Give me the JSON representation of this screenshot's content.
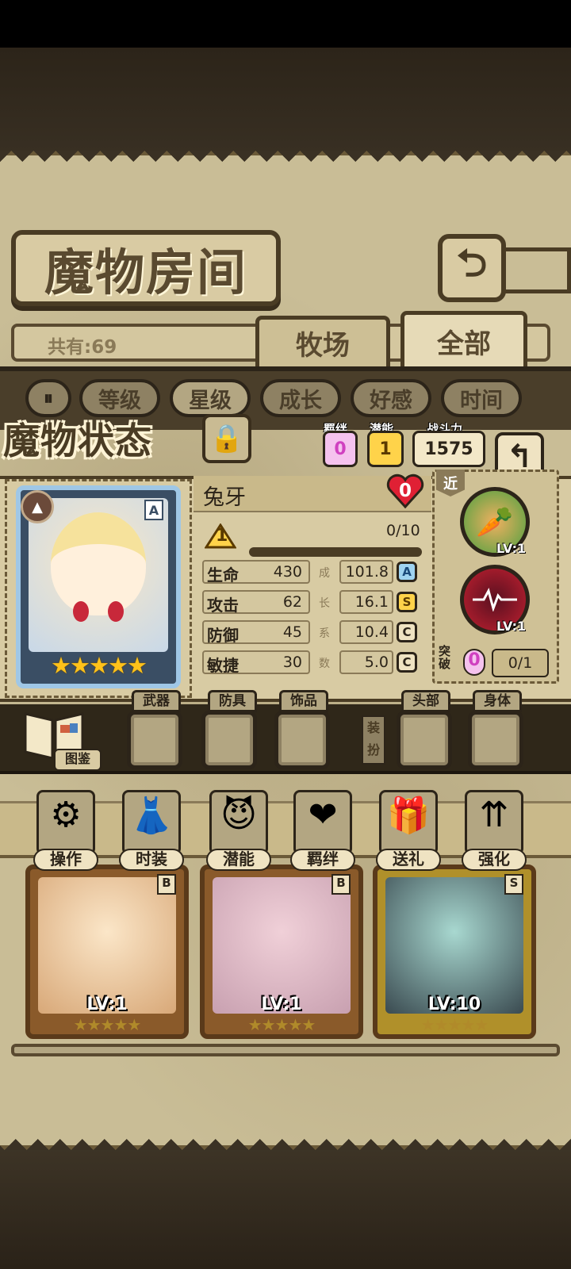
{
  "header": {
    "title": "魔物房间",
    "back_icon": "return-arrow-icon"
  },
  "collection": {
    "count_label": "共有:69"
  },
  "tabs": [
    {
      "label": "牧场"
    },
    {
      "label": "全部"
    }
  ],
  "sort": {
    "toggle_icon": "filter-toggle-icon",
    "buttons": [
      {
        "label": "等级"
      },
      {
        "label": "星级"
      },
      {
        "label": "成长"
      },
      {
        "label": "好感"
      },
      {
        "label": "时间"
      }
    ],
    "active": "星级"
  },
  "status": {
    "title": "魔物状态",
    "bond_label": "羁绊",
    "bond_value": "0",
    "potential_label": "潜能",
    "potential_value": "1",
    "power_label": "战斗力",
    "power_value": "1575"
  },
  "monster": {
    "name": "兔牙",
    "affection": "0",
    "rarity": "A",
    "stars": "★★★★★",
    "level": "1",
    "exp": "0/10",
    "exp_fraction": 0.0,
    "stats": [
      {
        "name": "生命",
        "value": "430",
        "growth": "101.8",
        "grade": "A"
      },
      {
        "name": "攻击",
        "value": "62",
        "growth": "16.1",
        "grade": "S"
      },
      {
        "name": "防御",
        "value": "45",
        "growth": "10.4",
        "grade": "C"
      },
      {
        "name": "敏捷",
        "value": "30",
        "growth": "5.0",
        "grade": "C"
      }
    ],
    "growth_chars": [
      "成",
      "长",
      "系",
      "数"
    ]
  },
  "skills": {
    "range_tag": "近",
    "items": [
      {
        "level": "LV:1",
        "icon": "carrot-burst-icon"
      },
      {
        "level": "LV:1",
        "icon": "heartbeat-icon"
      }
    ],
    "break_label_1": "突",
    "break_label_2": "破",
    "break_value": "0",
    "break_progress": "0/1"
  },
  "equipment": {
    "codex_label": "图鉴",
    "slots": [
      {
        "label": "武器"
      },
      {
        "label": "防具"
      },
      {
        "label": "饰品"
      },
      {
        "label": "头部"
      },
      {
        "label": "身体"
      }
    ],
    "dress_label_1": "装",
    "dress_label_2": "扮"
  },
  "actions": [
    {
      "label": "操作",
      "icon": "gear-icon"
    },
    {
      "label": "时装",
      "icon": "outfit-icon"
    },
    {
      "label": "潜能",
      "icon": "demon-icon"
    },
    {
      "label": "羁绊",
      "icon": "hearts-icon"
    },
    {
      "label": "送礼",
      "icon": "gift-icon"
    },
    {
      "label": "强化",
      "icon": "upgrade-arrows-icon"
    }
  ],
  "cards": [
    {
      "level": "LV:1",
      "grade": "B",
      "stars": "★★★★★"
    },
    {
      "level": "LV:1",
      "grade": "B",
      "stars": "★★★★★"
    },
    {
      "level": "LV:10",
      "grade": "S",
      "stars": "★★★★★"
    }
  ],
  "colors": {
    "panel": "#d8cba3",
    "frame": "#4a3c24",
    "accent_gold": "#ffc21a",
    "heart_red": "#e02034"
  }
}
